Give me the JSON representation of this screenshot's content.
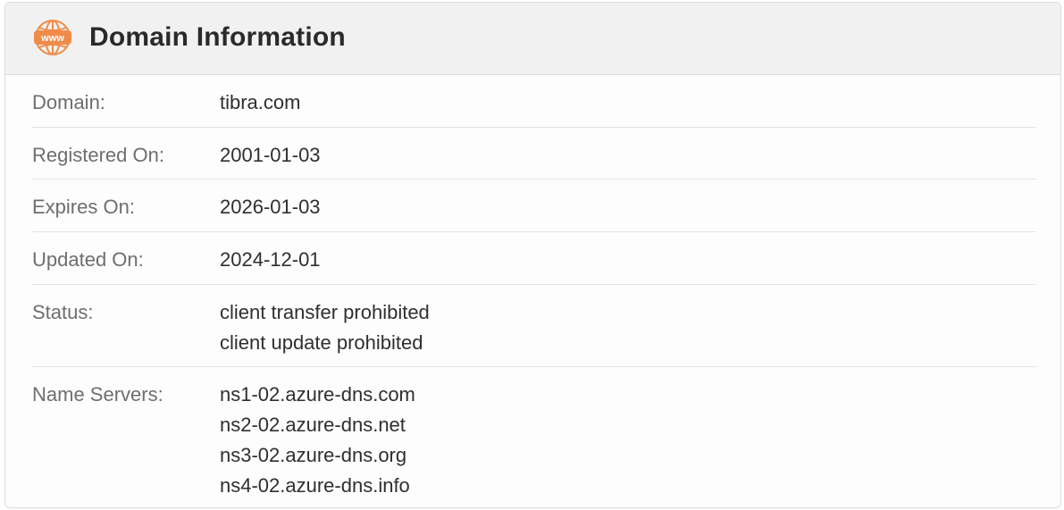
{
  "header": {
    "title": "Domain Information",
    "icon": "www-globe-icon",
    "icon_text": "www",
    "icon_color": "#f08c4a"
  },
  "rows": [
    {
      "label": "Domain:",
      "values": [
        "tibra.com"
      ]
    },
    {
      "label": "Registered On:",
      "values": [
        "2001-01-03"
      ]
    },
    {
      "label": "Expires On:",
      "values": [
        "2026-01-03"
      ]
    },
    {
      "label": "Updated On:",
      "values": [
        "2024-12-01"
      ]
    },
    {
      "label": "Status:",
      "values": [
        "client transfer prohibited",
        "client update prohibited"
      ]
    },
    {
      "label": "Name Servers:",
      "values": [
        "ns1-02.azure-dns.com",
        "ns2-02.azure-dns.net",
        "ns3-02.azure-dns.org",
        "ns4-02.azure-dns.info"
      ]
    }
  ]
}
